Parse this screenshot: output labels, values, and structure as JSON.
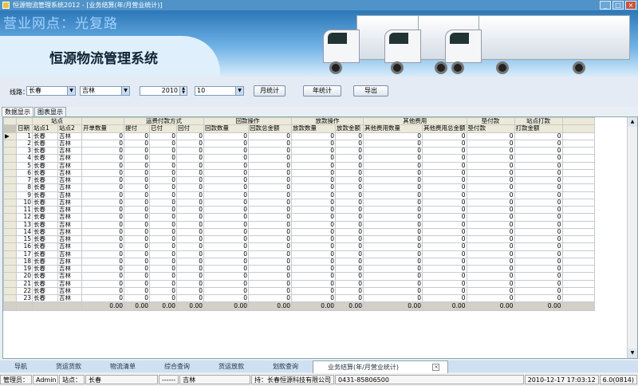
{
  "window": {
    "title": "恒源物流管理系统2012 - [业务结算(年/月营业统计)]",
    "min": "_",
    "max": "□",
    "close": "×"
  },
  "banner": {
    "network": "营业网点：光复路",
    "system_name": "恒源物流管理系统"
  },
  "toolbar": {
    "route_label": "线路：",
    "from_city": "长春",
    "to_city": "吉林",
    "year": "2010",
    "month": "10",
    "month_stat_button": "月统计",
    "year_stat_button": "年统计",
    "export_button": "导出"
  },
  "view_tabs": [
    "数据显示",
    "图表显示"
  ],
  "table": {
    "group_headers": [
      "站点",
      "运费付款方式",
      "回款操作",
      "放款操作",
      "其他费用",
      "垫付款",
      "站点打款"
    ],
    "columns": [
      "日期",
      "站点1",
      "站点2",
      "开单数量",
      "提付",
      "已付",
      "回付",
      "回款数量",
      "回款总金额",
      "放款数量",
      "放款金额",
      "其他费用数量",
      "其他费用总金额",
      "垫付款",
      "打款金额"
    ],
    "rows": [
      {
        "day": "1",
        "s1": "长春",
        "s2": "吉林"
      },
      {
        "day": "2",
        "s1": "长春",
        "s2": "吉林"
      },
      {
        "day": "3",
        "s1": "长春",
        "s2": "吉林"
      },
      {
        "day": "4",
        "s1": "长春",
        "s2": "吉林"
      },
      {
        "day": "5",
        "s1": "长春",
        "s2": "吉林"
      },
      {
        "day": "6",
        "s1": "长春",
        "s2": "吉林"
      },
      {
        "day": "7",
        "s1": "长春",
        "s2": "吉林"
      },
      {
        "day": "8",
        "s1": "长春",
        "s2": "吉林"
      },
      {
        "day": "9",
        "s1": "长春",
        "s2": "吉林"
      },
      {
        "day": "10",
        "s1": "长春",
        "s2": "吉林"
      },
      {
        "day": "11",
        "s1": "长春",
        "s2": "吉林"
      },
      {
        "day": "12",
        "s1": "长春",
        "s2": "吉林"
      },
      {
        "day": "13",
        "s1": "长春",
        "s2": "吉林"
      },
      {
        "day": "14",
        "s1": "长春",
        "s2": "吉林"
      },
      {
        "day": "15",
        "s1": "长春",
        "s2": "吉林"
      },
      {
        "day": "16",
        "s1": "长春",
        "s2": "吉林"
      },
      {
        "day": "17",
        "s1": "长春",
        "s2": "吉林"
      },
      {
        "day": "18",
        "s1": "长春",
        "s2": "吉林"
      },
      {
        "day": "19",
        "s1": "长春",
        "s2": "吉林"
      },
      {
        "day": "20",
        "s1": "长春",
        "s2": "吉林"
      },
      {
        "day": "21",
        "s1": "长春",
        "s2": "吉林"
      },
      {
        "day": "22",
        "s1": "长春",
        "s2": "吉林"
      },
      {
        "day": "23",
        "s1": "长春",
        "s2": "吉林"
      }
    ],
    "cell_value": "0",
    "total_value": "0.00",
    "current_row_marker": "▶"
  },
  "bottom_tabs": [
    "导航",
    "货运货款",
    "物流清单",
    "综合查询",
    "货运放款",
    "划款查询",
    "业务结算(年/月营业统计)"
  ],
  "bottom_tab_close": "×",
  "status": {
    "operator_label": "管理员：",
    "operator": "Admin",
    "site_label": "站点：",
    "site": "长春",
    "dest_prefix": "------",
    "dest": "吉林",
    "company": "持：长春恒源科技有限公司",
    "phone": "0431-85806500",
    "datetime": "2010-12-17 17:03:12",
    "version": "6.0(0814)"
  }
}
